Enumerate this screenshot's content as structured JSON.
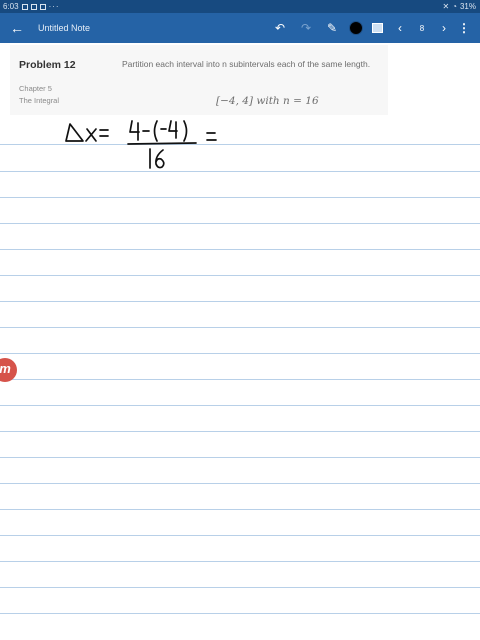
{
  "status_bar": {
    "time": "6:03",
    "battery": "31%",
    "overflow": "···"
  },
  "toolbar": {
    "back_icon": "arrow-left-icon",
    "title": "Untitled Note",
    "undo_icon": "undo-icon",
    "redo_icon": "redo-icon",
    "pen_icon": "pen-icon",
    "color": "#000000",
    "image_icon": "image-icon",
    "prev_icon": "chevron-left-icon",
    "page_number": "8",
    "next_icon": "chevron-right-icon",
    "more_icon": "more-vertical-icon"
  },
  "problem": {
    "title": "Problem 12",
    "chapter": "Chapter 5",
    "section": "The Integral",
    "statement": "Partition each interval into n subintervals each of the same length.",
    "math": "[−4, 4] with n = 16"
  },
  "colors": {
    "appbar": "#2563a6",
    "statusbar": "#174a80",
    "rule_line": "#b8d0e8",
    "ink": "#111111",
    "badge": "#d6534a"
  },
  "brand_badge_icon": "numerade-logo-icon"
}
